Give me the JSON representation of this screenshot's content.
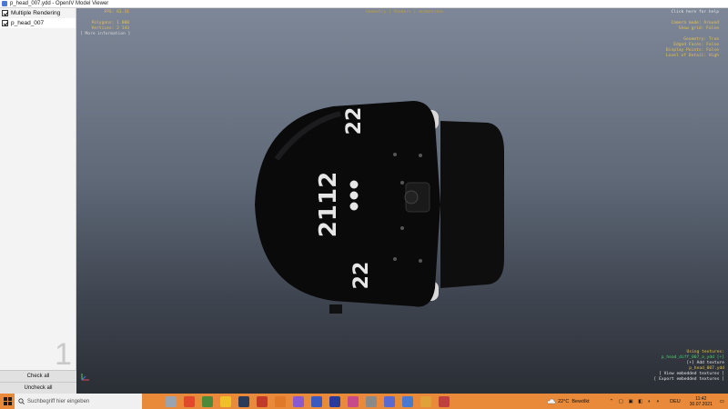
{
  "window": {
    "title": "p_head_007.ydd - OpenIV Model Viewer"
  },
  "sidebar": {
    "items": [
      {
        "label": "Multiple Rendering",
        "checked": true
      },
      {
        "label": "p_head_007",
        "checked": true
      }
    ],
    "lod_number": "1",
    "check_all": "Check all",
    "uncheck_all": "Uncheck all"
  },
  "overlay": {
    "stats": {
      "fps": "FPS: 61.31",
      "polygons": "Polygons: 1 000",
      "vertices": "Vertices: 2 143"
    },
    "more_info": "[ More information ]",
    "tabs": "Geometry | Shaders | Animations",
    "help": "Click here for help",
    "settings": [
      "Camera mode: Around",
      "Show grid: False",
      "",
      "Geometry: True",
      "Edged Faces: False",
      "Display Points: False",
      "Level of Detail: High"
    ],
    "textures": {
      "heading": "Using textures:",
      "file": "p_head_diff_007_a_ydd [+]",
      "add": "[+] Add texture",
      "ytd": "p_head_007.ydd",
      "view": "[ View embedded textures ]",
      "export": "[ Export embedded textures ]"
    }
  },
  "model": {
    "number_side": "2112",
    "number_top": "22",
    "number_bottom": "22"
  },
  "taskbar": {
    "search_placeholder": "Suchbegriff hier eingeben",
    "temperature": "22°C",
    "weather": "Bewölkt",
    "language": "DEU",
    "time": "11:42",
    "date": "30.07.2021",
    "accent": "#e88a3a"
  }
}
